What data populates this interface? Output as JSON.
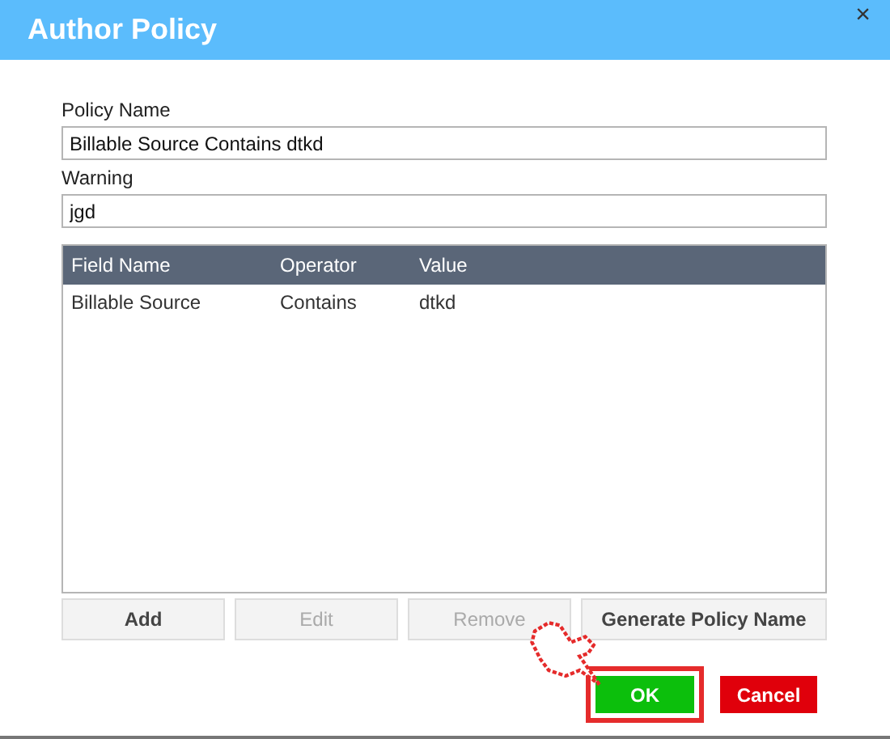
{
  "window": {
    "title": "Author Policy",
    "close": "×"
  },
  "fields": [
    {
      "label": "Policy Name",
      "value": "Billable Source Contains dtkd"
    },
    {
      "label": "Warning",
      "value": "jgd"
    }
  ],
  "table": {
    "columns": [
      "Field Name",
      "Operator",
      "Value"
    ],
    "rows": [
      [
        "Billable Source",
        "Contains",
        "dtkd"
      ]
    ]
  },
  "actions": [
    {
      "label": "Add",
      "disabled": false
    },
    {
      "label": "Edit",
      "disabled": true
    },
    {
      "label": "Remove",
      "disabled": true
    },
    {
      "label": "Generate Policy Name",
      "disabled": false
    }
  ],
  "dialog_buttons": [
    {
      "label": "OK",
      "kind": "ok",
      "highlighted": true
    },
    {
      "label": "Cancel",
      "kind": "cancel",
      "highlighted": false
    }
  ]
}
